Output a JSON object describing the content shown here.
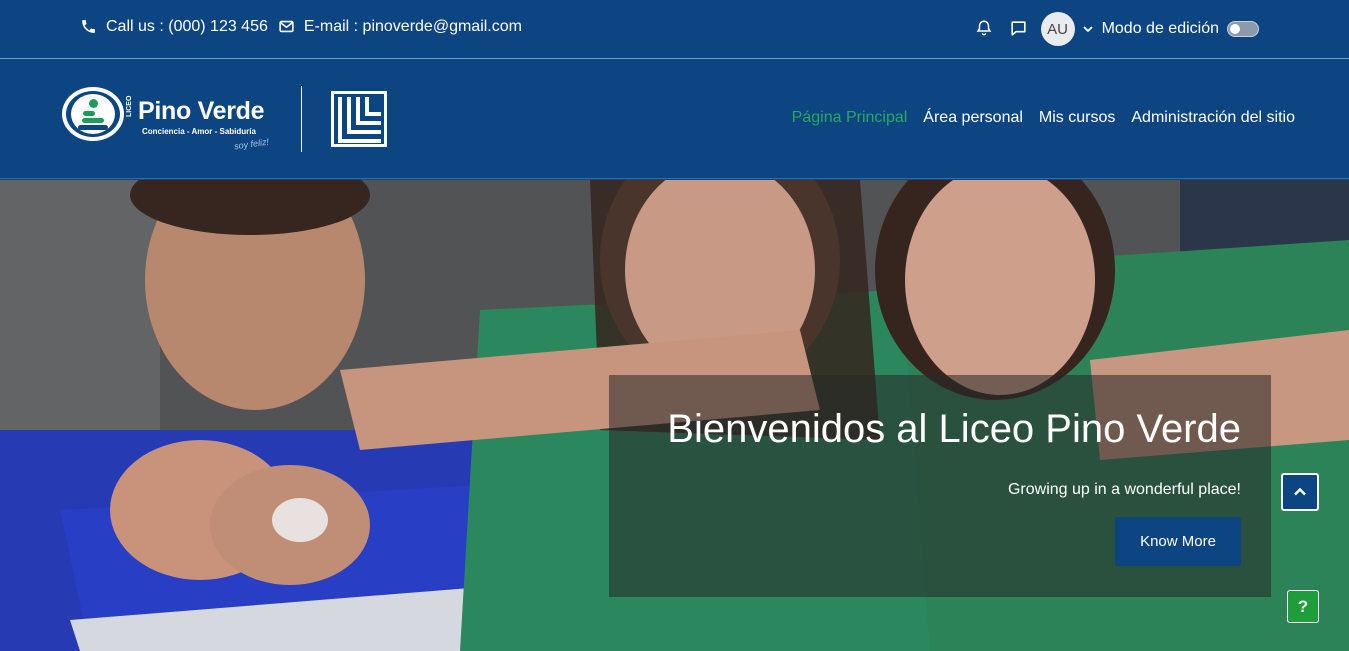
{
  "topbar": {
    "phone_icon": "phone-icon",
    "phone_text": "Call us : (000) 123 456",
    "mail_icon": "envelope-icon",
    "email_text": "E-mail : pinoverde@gmail.com",
    "notifications_icon": "bell-icon",
    "messages_icon": "chat-icon",
    "avatar_initials": "AU",
    "edit_mode_label": "Modo de edición"
  },
  "header": {
    "logo": {
      "liceo": "LICEO",
      "name": "Pino Verde",
      "tagline": "Conciencia - Amor - Sabiduría",
      "slogan": "soy feliz!"
    },
    "nav": [
      {
        "label": "Página Principal",
        "active": true
      },
      {
        "label": "Área personal",
        "active": false
      },
      {
        "label": "Mis cursos",
        "active": false
      },
      {
        "label": "Administración del sitio",
        "active": false
      }
    ]
  },
  "hero": {
    "title": "Bienvenidos al Liceo Pino Verde",
    "subtitle": "Growing up in a wonderful place!",
    "button_label": "Know More"
  },
  "floating": {
    "scroll_top_icon": "chevron-up-icon",
    "help_label": "?"
  },
  "colors": {
    "primary": "#0c4582",
    "accent_green": "#27a95f",
    "help_green": "#1f9d3a"
  }
}
